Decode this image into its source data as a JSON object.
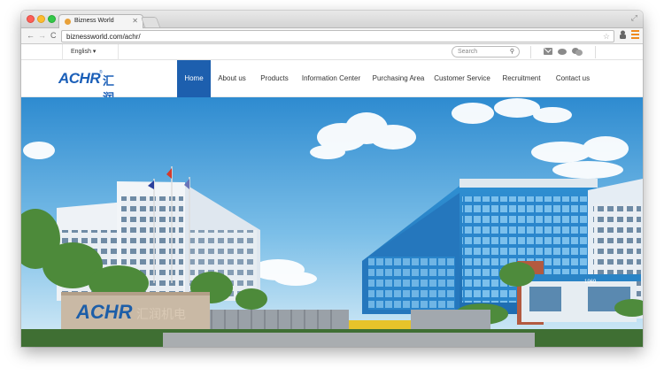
{
  "browser": {
    "tab_title": "Bizness World",
    "url": "biznessworld.com/achr/"
  },
  "utility_bar": {
    "language": "English ▾",
    "search_placeholder": "Search"
  },
  "brand": {
    "logo_text": "ACHR",
    "logo_mark": "®",
    "logo_cn": "汇润机电"
  },
  "nav": {
    "items": [
      {
        "label": "Home",
        "active": true
      },
      {
        "label": "About us"
      },
      {
        "label": "Products"
      },
      {
        "label": "Information Center"
      },
      {
        "label": "Purchasing Area"
      },
      {
        "label": "Customer Service"
      },
      {
        "label": "Recruitment"
      },
      {
        "label": "Contact us"
      }
    ]
  },
  "hero": {
    "sign_text": "ACHR",
    "sign_cn": "汇润机电",
    "gatehouse_number": "1969"
  },
  "colors": {
    "brand_blue": "#1b5fb8",
    "nav_active": "#1d5fae",
    "sky_top": "#2e8bd0"
  }
}
